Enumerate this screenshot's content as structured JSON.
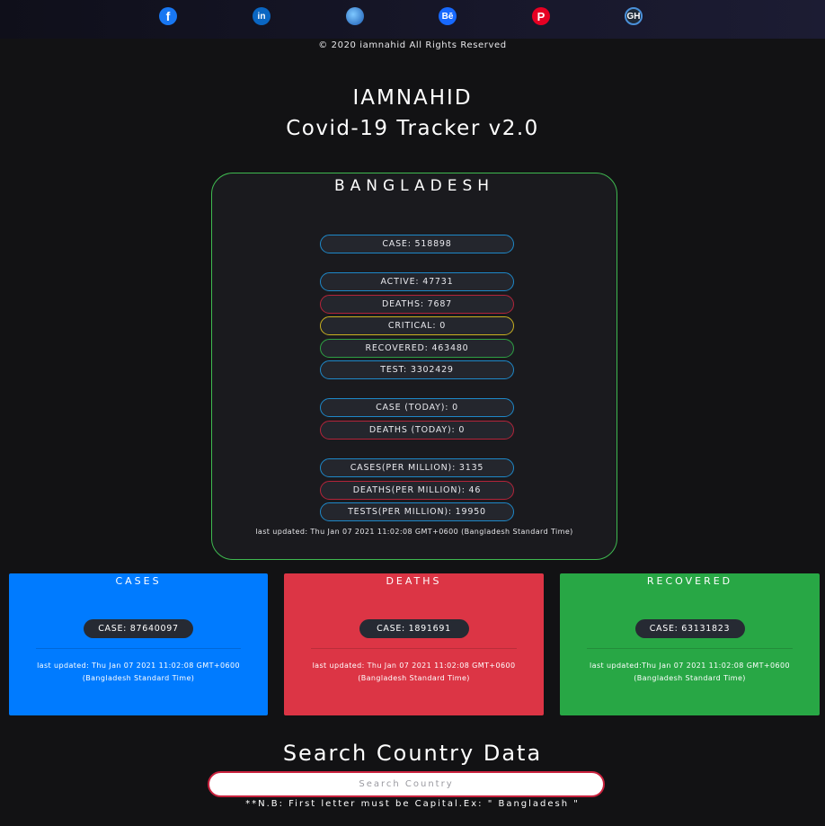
{
  "social": {
    "facebook_glyph": "f",
    "linkedin_glyph": "in",
    "website_glyph": "",
    "behance_glyph": "Bē",
    "pinterest_glyph": "P",
    "github_glyph": "GH"
  },
  "footer": {
    "copyright": "© 2020  iamnahid  All Rights Reserved"
  },
  "header": {
    "title": "IAMNAHID",
    "subtitle": "Covid-19 Tracker v2.0"
  },
  "country": {
    "name": "BANGLADESH",
    "case": "CASE: 518898",
    "active": "ACTIVE: 47731",
    "deaths": "DEATHS: 7687",
    "critical": "CRITICAL: 0",
    "recovered": "RECOVERED: 463480",
    "test": "TEST: 3302429",
    "case_today": "CASE (TODAY): 0",
    "deaths_today": "DEATHS (TODAY): 0",
    "cases_per_million": "CASES(PER MILLION): 3135",
    "deaths_per_million": "DEATHS(PER MILLION): 46",
    "tests_per_million": "TESTS(PER MILLION): 19950",
    "last_updated": "last updated: Thu Jan 07 2021 11:02:08 GMT+0600 (Bangladesh Standard Time)"
  },
  "global": {
    "cases": {
      "title": "CASES",
      "value": "CASE: 87640097",
      "updated_line1": "last updated: Thu Jan 07 2021 11:02:08 GMT+0600",
      "updated_line2": "(Bangladesh Standard Time)"
    },
    "deaths": {
      "title": "DEATHS",
      "value": "CASE: 1891691",
      "updated_line1": "last updated: Thu Jan 07 2021 11:02:08 GMT+0600",
      "updated_line2": "(Bangladesh Standard Time)"
    },
    "recovered": {
      "title": "RECOVERED",
      "value": "CASE: 63131823",
      "updated_line1": "last updated:Thu Jan 07 2021 11:02:08 GMT+0600",
      "updated_line2": "(Bangladesh Standard Time)"
    }
  },
  "search": {
    "title": "Search Country Data",
    "placeholder": "Search Country",
    "note": "**N.B: First letter must be Capital.Ex: \" Bangladesh \""
  },
  "colors": {
    "cases_card": "#007bff",
    "deaths_card": "#dc3545",
    "recovered_card": "#28a745",
    "panel_border": "#3fb950"
  }
}
